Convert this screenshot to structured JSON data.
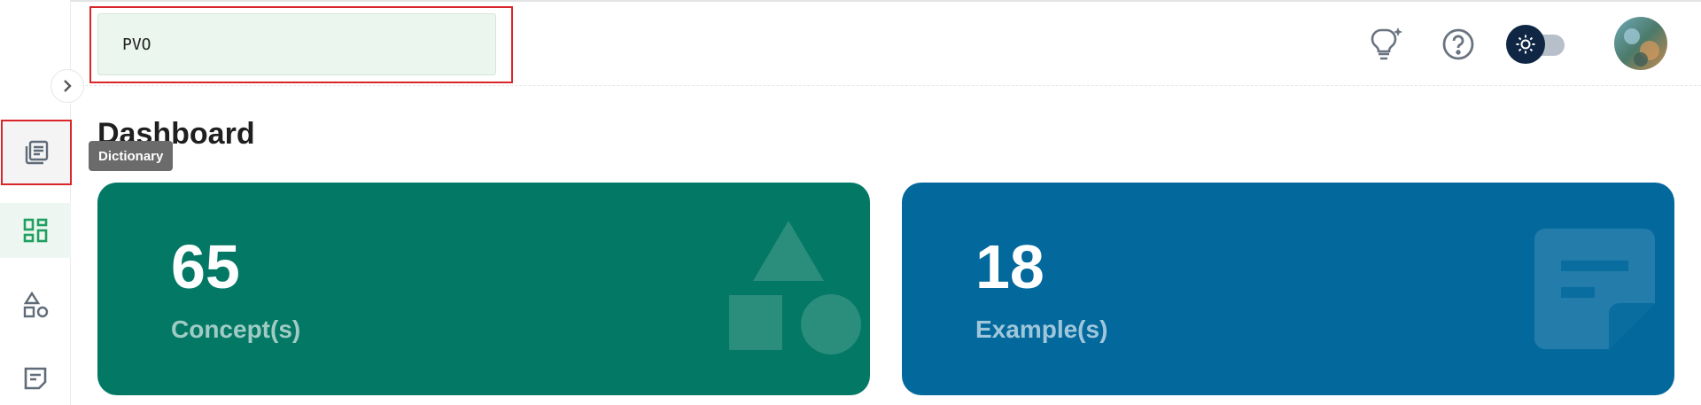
{
  "search": {
    "value": "PVO"
  },
  "sidebar": {
    "items": [
      {
        "icon": "dictionary-icon",
        "tooltip": "Dictionary"
      },
      {
        "icon": "dashboard-icon"
      },
      {
        "icon": "shapes-icon"
      },
      {
        "icon": "notes-icon"
      }
    ]
  },
  "header": {
    "icons": [
      "lightbulb-sparkle-icon",
      "help-circle-icon",
      "theme-toggle",
      "user-avatar"
    ]
  },
  "page": {
    "title": "Dashboard"
  },
  "cards": [
    {
      "value": "65",
      "label": "Concept(s)",
      "color": "#037864"
    },
    {
      "value": "18",
      "label": "Example(s)",
      "color": "#03699d"
    }
  ],
  "colors": {
    "accent": "#1fa060",
    "highlight": "#d8262b",
    "theme_knob": "#0f2744"
  }
}
